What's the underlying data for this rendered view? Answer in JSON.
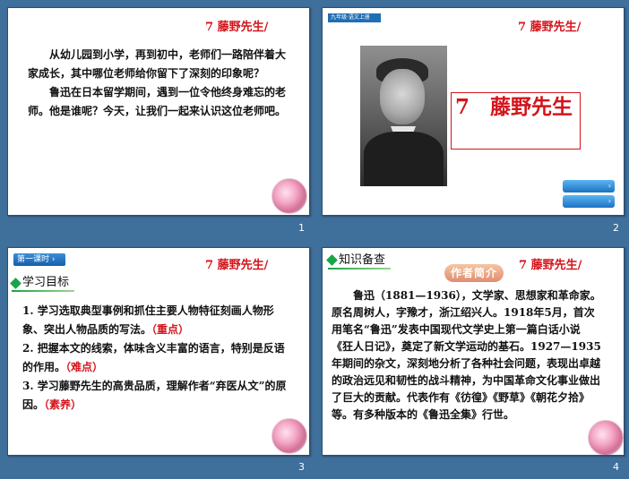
{
  "slides": [
    {
      "number": "1",
      "title": "7 藤野先生/",
      "paragraphs": [
        "从幼儿园到小学，再到初中，老师们一路陪伴着大家成长，其中哪位老师给你留下了深刻的印象呢？",
        "鲁迅在日本留学期间，遇到一位令他终身难忘的老师。他是谁呢？今天，让我们一起来认识这位老师吧。"
      ]
    },
    {
      "number": "2",
      "title": "7 藤野先生/",
      "badge": "九年级·语文上册",
      "big_title": "7　藤野先生",
      "nav_buttons": [
        "›",
        "›"
      ]
    },
    {
      "number": "3",
      "title": "7 藤野先生/",
      "lesson_badge": "第一课时 ›",
      "section": "学习目标",
      "goals": [
        {
          "text": "1. 学习选取典型事例和抓住主要人物特征刻画人物形象、突出人物品质的写法。",
          "tag": "（重点）"
        },
        {
          "text": "2. 把握本文的线索，体味含义丰富的语言，特别是反语的作用。",
          "tag": "（难点）"
        },
        {
          "text": "3. 学习藤野先生的高贵品质，理解作者“弃医从文”的原因。",
          "tag": "（素养）"
        }
      ]
    },
    {
      "number": "4",
      "title": "7 藤野先生/",
      "section": "知识备查",
      "banner": "作者简介",
      "lines": [
        "　　鲁迅（1881—1936），文学家、思想家和革命家。原名周树人，字豫才，浙江绍兴人。1918年5月，首次用笔名“鲁迅”发表中国现代文学史上第一篇白话小说",
        "《狂人日记》，奠定了新文学运动的基石。1927—1935年期间的杂文，深刻地分析了各种社会问题，表现出卓越的政治远见和韧性的战斗精神，为中国革命文化事业做出了巨大的贡献。代表作有《彷徨》《野草》《朝花夕拾》等。有多种版本的《鲁迅全集》行世。"
      ]
    }
  ]
}
